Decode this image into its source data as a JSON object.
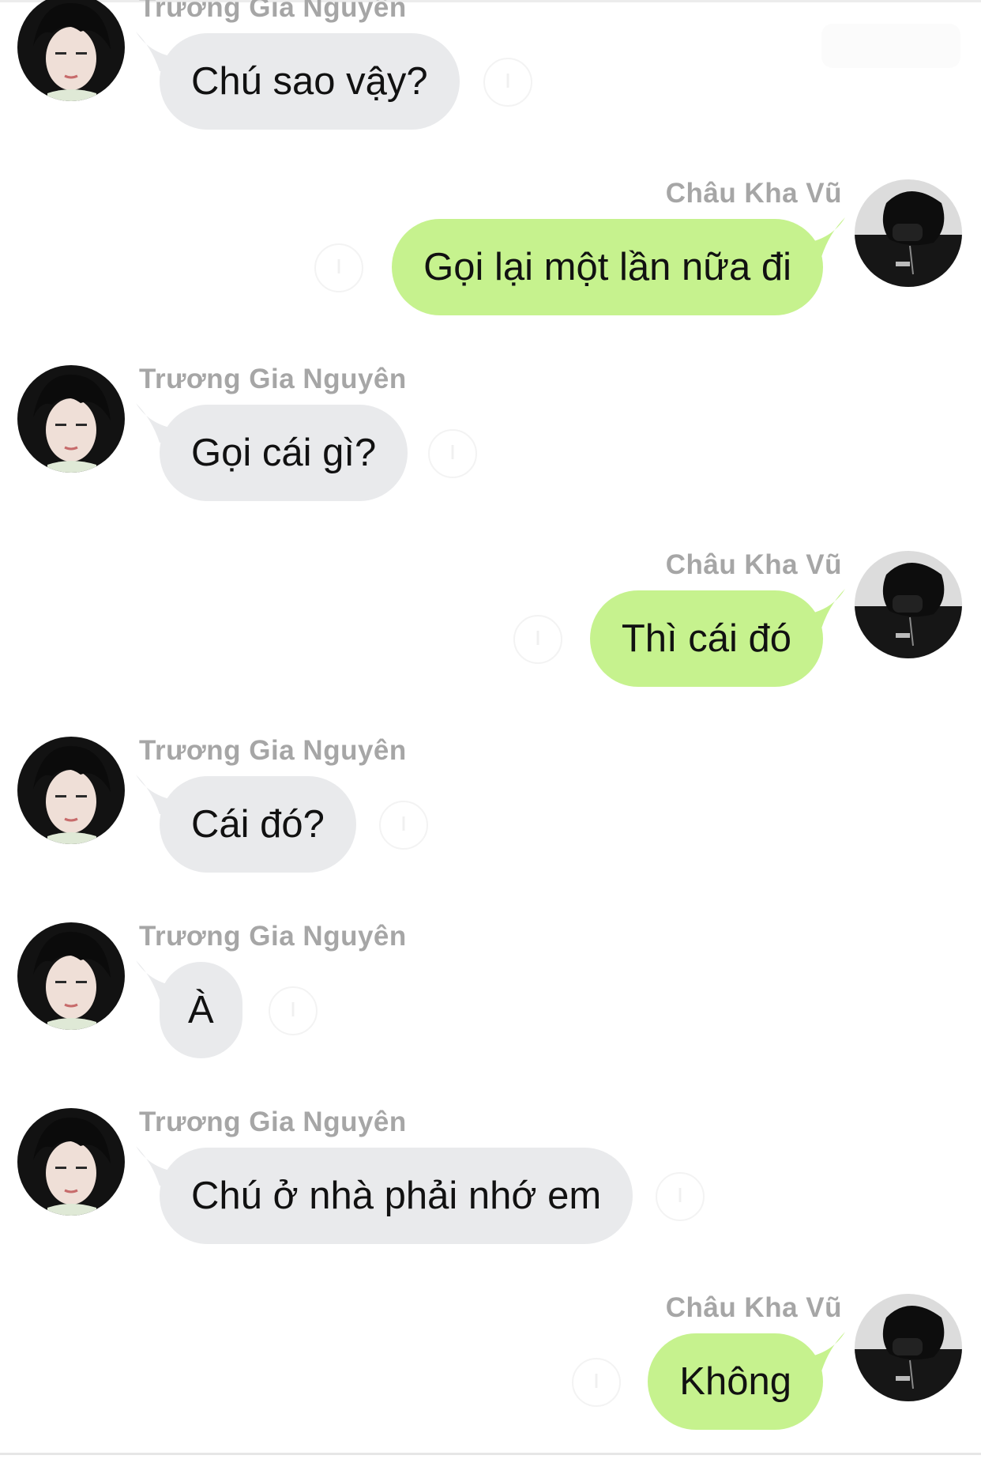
{
  "contacts": {
    "other": "Trương Gia Nguyên",
    "me": "Châu Kha Vũ"
  },
  "colors": {
    "incoming_bubble": "#e9eaec",
    "outgoing_bubble": "#c6f28e",
    "sender_name": "#a6a6a6",
    "text": "#111111"
  },
  "messages": [
    {
      "side": "left",
      "sender": "Trương Gia Nguyên",
      "text": "Chú sao vậy?"
    },
    {
      "side": "right",
      "sender": "Châu Kha Vũ",
      "text": "Gọi lại một lần nữa đi"
    },
    {
      "side": "left",
      "sender": "Trương Gia Nguyên",
      "text": "Gọi cái gì?"
    },
    {
      "side": "right",
      "sender": "Châu Kha Vũ",
      "text": "Thì cái đó"
    },
    {
      "side": "left",
      "sender": "Trương Gia Nguyên",
      "text": "Cái đó?"
    },
    {
      "side": "left",
      "sender": "Trương Gia Nguyên",
      "text": "À"
    },
    {
      "side": "left",
      "sender": "Trương Gia Nguyên",
      "text": "Chú ở nhà phải nhớ em"
    },
    {
      "side": "right",
      "sender": "Châu Kha Vũ",
      "text": "Không"
    }
  ],
  "icons": {
    "avatar_left": "avatar-truong-gia-nguyen",
    "avatar_right": "avatar-chau-kha-vu",
    "reply": "reply-icon"
  }
}
